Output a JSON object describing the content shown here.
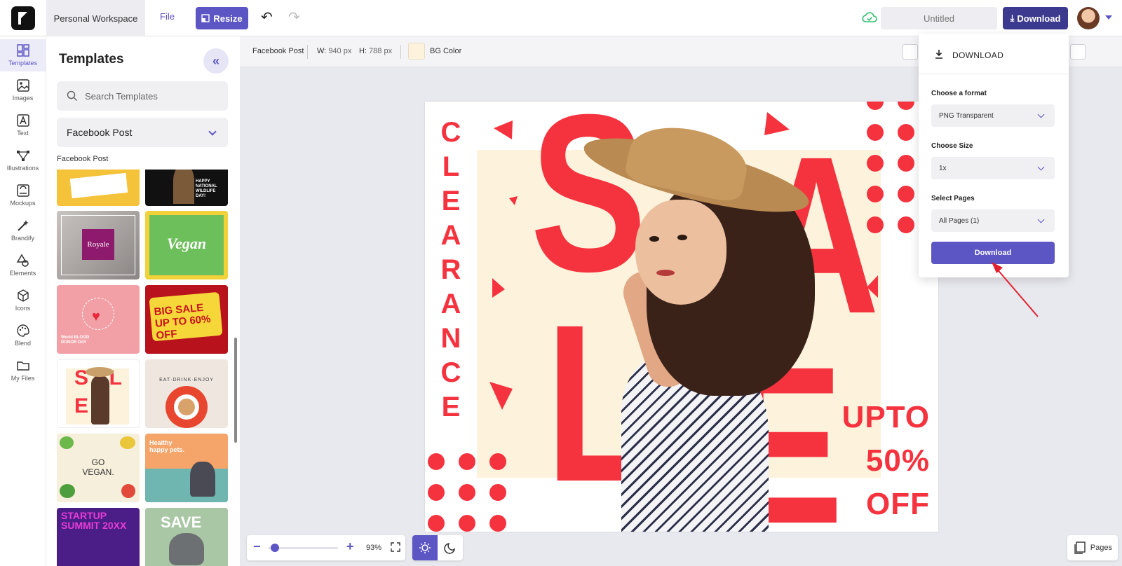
{
  "app": {
    "workspace": "Personal Workspace",
    "file_label": "File",
    "resize_label": "Resize",
    "title_placeholder": "Untitled",
    "download_label": "Download"
  },
  "rail": [
    {
      "label": "Templates",
      "icon": "templates-icon"
    },
    {
      "label": "Images",
      "icon": "image-icon"
    },
    {
      "label": "Text",
      "icon": "text-icon"
    },
    {
      "label": "Illustrations",
      "icon": "illustration-icon"
    },
    {
      "label": "Mockups",
      "icon": "mockup-icon"
    },
    {
      "label": "Brandify",
      "icon": "magic-wand-icon"
    },
    {
      "label": "Elements",
      "icon": "shapes-icon"
    },
    {
      "label": "Icons",
      "icon": "cube-icon"
    },
    {
      "label": "Blend",
      "icon": "palette-icon"
    },
    {
      "label": "My Files",
      "icon": "folder-icon"
    }
  ],
  "panel": {
    "title": "Templates",
    "search_placeholder": "Search Templates",
    "category": "Facebook Post",
    "section_label": "Facebook Post"
  },
  "thumbnails": [
    {
      "name": "recipe-book",
      "text": ""
    },
    {
      "name": "wildlife-day",
      "text": "HAPPY NATIONAL WILDLIFE DAY!"
    },
    {
      "name": "royale-wedding",
      "text": "Royale"
    },
    {
      "name": "vegan",
      "text": "Vegan"
    },
    {
      "name": "blood-donor-day",
      "text": "World BLOOD DONOR DAY"
    },
    {
      "name": "big-sale",
      "text": "BIG SALE UP TO 60% OFF"
    },
    {
      "name": "clearance-sale",
      "text": "SALE"
    },
    {
      "name": "eat-drink-enjoy",
      "text": "EAT·DRINK·ENJOY"
    },
    {
      "name": "go-vegan",
      "text": "GO VEGAN."
    },
    {
      "name": "healthy-pets",
      "text": "Healthy happy pets."
    },
    {
      "name": "startup-summit",
      "text": "STARTUP SUMMIT 20XX"
    },
    {
      "name": "save-elephant",
      "text": "SAVE"
    }
  ],
  "toolbar": {
    "doc_type": "Facebook Post",
    "w_label": "W:",
    "w_value": "940 px",
    "h_label": "H:",
    "h_value": "788 px",
    "bg_label": "BG Color",
    "bg_color": "#fdf3dc"
  },
  "artboard": {
    "clearance": [
      "C",
      "L",
      "E",
      "A",
      "R",
      "A",
      "N",
      "C",
      "E"
    ],
    "big_letters": [
      "S",
      "A",
      "L",
      "E"
    ],
    "offer": [
      "UPTO",
      "50%",
      "OFF"
    ],
    "accent": "#f5333f"
  },
  "zoom": {
    "value": "93%",
    "level": 0.05
  },
  "pages_label": "Pages",
  "download_panel": {
    "header": "DOWNLOAD",
    "format_label": "Choose a format",
    "format_value": "PNG Transparent",
    "size_label": "Choose Size",
    "size_value": "1x",
    "pages_label": "Select Pages",
    "pages_value": "All Pages (1)",
    "button": "Download"
  },
  "colors": {
    "accent": "#5c55c4",
    "download_dark": "#3c3a8f",
    "sale_red": "#f5333f"
  }
}
